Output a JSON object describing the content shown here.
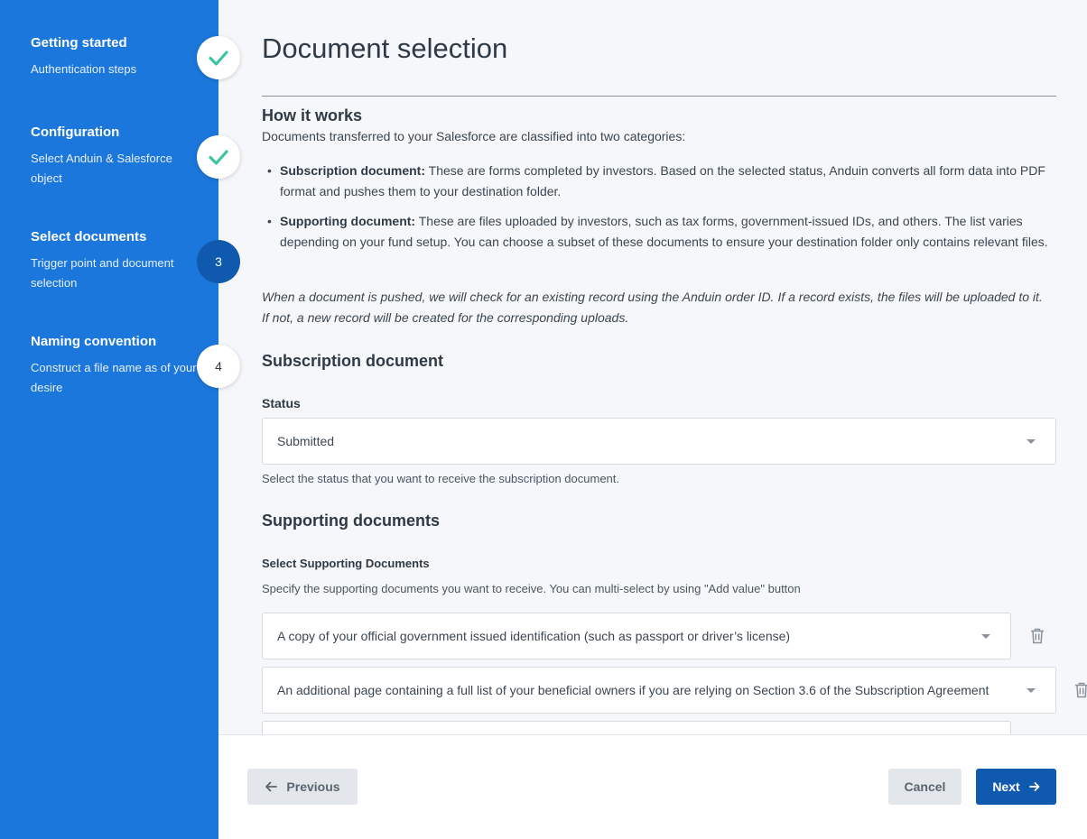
{
  "sidebar": {
    "steps": [
      {
        "title": "Getting started",
        "desc": "Authentication steps",
        "state": "done"
      },
      {
        "title": "Configuration",
        "desc": "Select Anduin & Salesforce object",
        "state": "done"
      },
      {
        "title": "Select documents",
        "desc": "Trigger point and document selection",
        "state": "active",
        "number": "3"
      },
      {
        "title": "Naming convention",
        "desc": "Construct a file name as of your desire",
        "state": "todo",
        "number": "4"
      }
    ]
  },
  "main": {
    "title": "Document selection",
    "how_it_works": {
      "heading": "How it works",
      "intro": "Documents transferred to your Salesforce are classified into two categories:",
      "bullets": [
        {
          "term": "Subscription document:",
          "text": " These are forms completed by investors. Based on the selected status, Anduin converts all form data into PDF format and pushes them to your destination folder."
        },
        {
          "term": "Supporting document:",
          "text": " These are files uploaded by investors, such as tax forms, government-issued IDs, and others. The list varies depending on your fund setup. You can choose a subset of these documents to ensure your destination folder only contains relevant files."
        }
      ],
      "note": "When a document is pushed, we will check for an existing record using the Anduin order ID. If a record exists, the files will be uploaded to it. If not, a new record will be created for the corresponding uploads."
    },
    "subscription": {
      "heading": "Subscription document",
      "status_label": "Status",
      "status_value": "Submitted",
      "status_help": "Select the status that you want to receive the subscription document."
    },
    "supporting": {
      "heading": "Supporting documents",
      "select_label": "Select Supporting Documents",
      "select_help": "Specify the supporting documents you want to receive. You can multi-select by using \"Add value\" button",
      "items": [
        "A copy of your official government issued identification (such as passport or driver’s license)",
        "An additional page containing a full list of your beneficial owners if you are relying on Section 3.6 of the Subscription Agreement",
        ""
      ]
    }
  },
  "footer": {
    "previous_label": "Previous",
    "cancel_label": "Cancel",
    "next_label": "Next"
  },
  "colors": {
    "sidebar_bg": "#1b77db",
    "active_step": "#0f5aae",
    "check": "#3cc3a0",
    "primary_button": "#0f5aae"
  }
}
